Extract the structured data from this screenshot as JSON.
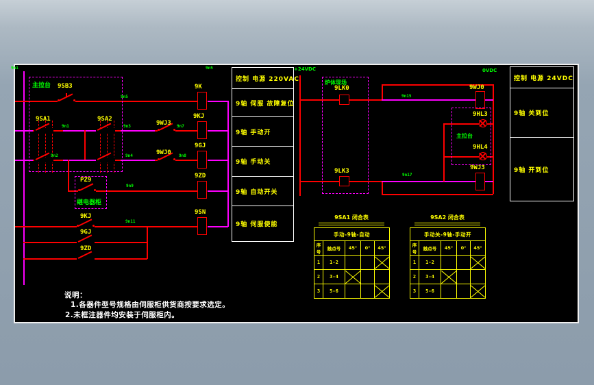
{
  "colors": {
    "wire_red": "#ff0000",
    "wire_magenta": "#ff00ff",
    "label_yellow": "#ffff00",
    "label_green": "#00ff00",
    "sheet_bg": "#000000",
    "frame_white": "#efefef",
    "margin_gray": "#8c9cab"
  },
  "left_ladder": {
    "console_label": "主拉台",
    "cabinet_label": "继电器柜",
    "contacts": {
      "sb3": "9SB3",
      "sa1": "9SA1",
      "sa2": "9SA2",
      "wj3": "9WJ3",
      "wj0": "9WJ0",
      "pz9": "PZ9",
      "kj": "9KJ",
      "gj": "9GJ",
      "zd": "9ZD"
    },
    "coils": {
      "k": "9K",
      "kj": "9KJ",
      "gj": "9GJ",
      "zd": "9ZD",
      "sn": "9SN"
    }
  },
  "signal_boxes_left": [
    "控制 电源 220VAC",
    "9轴 伺服 故障复位",
    "9轴 手动开",
    "9轴 手动关",
    "9轴 自动开关",
    "9轴 伺服使能"
  ],
  "middle_circuit": {
    "rail_pos": "+24VDC",
    "rail_neg": "0VDC",
    "field_label": "炉体现场",
    "console_label": "主拉台",
    "lk0": "9LK0",
    "lk3": "9LK3",
    "wj0": "9WJ0",
    "wj3": "9WJ3",
    "hl3": "9HL3",
    "hl4": "9HL4"
  },
  "signal_boxes_right": [
    "控制 电源 24VDC",
    "9轴 关到位",
    "9轴 开到位"
  ],
  "wire_numbers": {
    "tl": "9n1",
    "tr": "9n5",
    "r1": "9n5",
    "r2a": "9n1",
    "r2b": "9n3",
    "r2c": "9n7",
    "r3a": "9n2",
    "r3b": "9n4",
    "r3c": "9n8",
    "r4": "9n9",
    "r5": "9n11",
    "m_top": "9n15",
    "m_bot": "9n17"
  },
  "tables": [
    {
      "title": "9SA1 闭合表",
      "mode_header": "手动-9轴-自动",
      "col_headers": [
        "序号",
        "触点号",
        "45°",
        "0°",
        "45°"
      ],
      "rows": [
        {
          "no": "1",
          "contact": "1-2",
          "marks": [
            false,
            false,
            true
          ]
        },
        {
          "no": "2",
          "contact": "3-4",
          "marks": [
            true,
            false,
            false
          ]
        },
        {
          "no": "3",
          "contact": "5-6",
          "marks": [
            false,
            false,
            true
          ]
        }
      ]
    },
    {
      "title": "9SA2 闭合表",
      "mode_header": "手动关-9轴-手动开",
      "col_headers": [
        "序号",
        "触点号",
        "45°",
        "0°",
        "45°"
      ],
      "rows": [
        {
          "no": "1",
          "contact": "1-2",
          "marks": [
            false,
            false,
            true
          ]
        },
        {
          "no": "2",
          "contact": "3-4",
          "marks": [
            true,
            false,
            false
          ]
        },
        {
          "no": "3",
          "contact": "5-6",
          "marks": [
            false,
            false,
            true
          ]
        }
      ]
    }
  ],
  "notes": {
    "heading": "说明：",
    "items": [
      "1.各器件型号规格由伺服柜供货商按要求选定。",
      "2.未框注器件均安装于伺服柜内。"
    ]
  }
}
